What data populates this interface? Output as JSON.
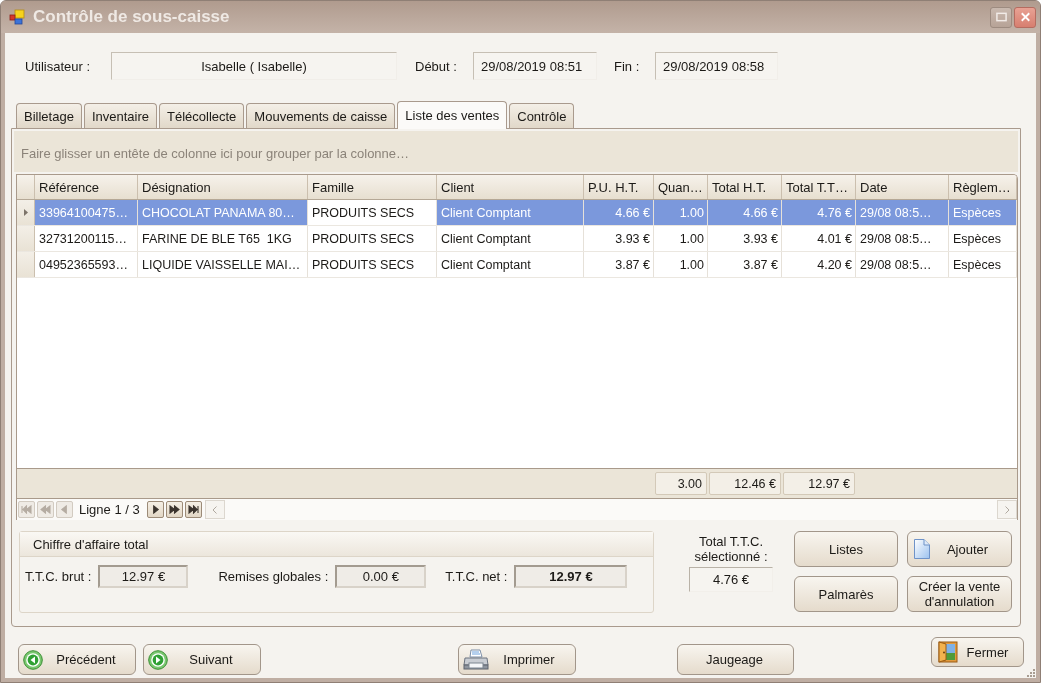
{
  "window": {
    "title": "Contrôle de sous-caisse"
  },
  "session": {
    "user": {
      "label": "Utilisateur :",
      "value": "Isabelle ( Isabelle)"
    },
    "start": {
      "label": "Début :",
      "value": "29/08/2019 08:51"
    },
    "end": {
      "label": "Fin :",
      "value": "29/08/2019 08:58"
    }
  },
  "tabs": [
    {
      "label": "Billetage",
      "selected": false
    },
    {
      "label": "Inventaire",
      "selected": false
    },
    {
      "label": "Télécollecte",
      "selected": false
    },
    {
      "label": "Mouvements de caisse",
      "selected": false
    },
    {
      "label": "Liste des ventes",
      "selected": true
    },
    {
      "label": "Contrôle",
      "selected": false
    }
  ],
  "sales_grid": {
    "group_hint": "Faire glisser un entête de colonne ici pour grouper par la colonne…",
    "columns": [
      {
        "label": "Référence",
        "kind": "text",
        "focused": false
      },
      {
        "label": "Désignation",
        "kind": "text",
        "focused": false
      },
      {
        "label": "Famille",
        "kind": "text",
        "focused": true
      },
      {
        "label": "Client",
        "kind": "text",
        "focused": false
      },
      {
        "label": "P.U. H.T.",
        "kind": "number",
        "focused": false
      },
      {
        "label": "Quan…",
        "kind": "number",
        "focused": false,
        "total": "3.00"
      },
      {
        "label": "Total H.T.",
        "kind": "number",
        "focused": false,
        "total": "12.46 €"
      },
      {
        "label": "Total T.T…",
        "kind": "number",
        "focused": false,
        "total": "12.97 €"
      },
      {
        "label": "Date",
        "kind": "text",
        "focused": false
      },
      {
        "label": "Règlem…",
        "kind": "text",
        "focused": false
      }
    ],
    "rows": [
      {
        "selected": true,
        "cells": [
          "33964100475…",
          "CHOCOLAT PANAMA 80…",
          "PRODUITS SECS",
          "Client Comptant",
          "4.66 €",
          "1.00",
          "4.66 €",
          "4.76 €",
          "29/08 08:5…",
          "Espèces"
        ]
      },
      {
        "selected": false,
        "cells": [
          "32731200115…",
          "FARINE DE BLE T65  1KG",
          "PRODUITS SECS",
          "Client Comptant",
          "3.93 €",
          "1.00",
          "3.93 €",
          "4.01 €",
          "29/08 08:5…",
          "Espèces"
        ]
      },
      {
        "selected": false,
        "cells": [
          "04952365593…",
          "LIQUIDE VAISSELLE MAI…",
          "PRODUITS SECS",
          "Client Comptant",
          "3.87 €",
          "1.00",
          "3.87 €",
          "4.20 €",
          "29/08 08:5…",
          "Espèces"
        ]
      }
    ],
    "navigator": {
      "label": "Ligne 1 / 3",
      "buttons": [
        {
          "kind": "first",
          "disabled": true
        },
        {
          "kind": "previous_page",
          "disabled": true
        },
        {
          "kind": "previous",
          "disabled": true
        },
        {
          "kind": "next",
          "disabled": false
        },
        {
          "kind": "next_page",
          "disabled": false
        },
        {
          "kind": "last",
          "disabled": false
        }
      ]
    }
  },
  "revenue": {
    "title": "Chiffre d'affaire total",
    "fields": [
      {
        "label": "T.T.C. brut :",
        "value": "12.97 €",
        "emphasized": false
      },
      {
        "label": "Remises globales :",
        "value": "0.00 €",
        "emphasized": false
      },
      {
        "label": "T.T.C. net :",
        "value": "12.97 €",
        "emphasized": true
      }
    ]
  },
  "selected_total": {
    "label": "Total T.T.C. sélectionné :",
    "value": "4.76 €"
  },
  "side_buttons": [
    {
      "label": "Listes",
      "kind": "plain"
    },
    {
      "label": "Ajouter",
      "kind": "add"
    },
    {
      "label": "Palmarès",
      "kind": "plain"
    },
    {
      "label": "Créer la vente d'annulation",
      "kind": "plain"
    }
  ],
  "footer_buttons": [
    {
      "label": "Précédent",
      "kind": "previous"
    },
    {
      "label": "Suivant",
      "kind": "next"
    },
    {
      "label": "Imprimer",
      "kind": "print"
    },
    {
      "label": "Jaugeage",
      "kind": "plain"
    },
    {
      "label": "Fermer",
      "kind": "close"
    }
  ]
}
